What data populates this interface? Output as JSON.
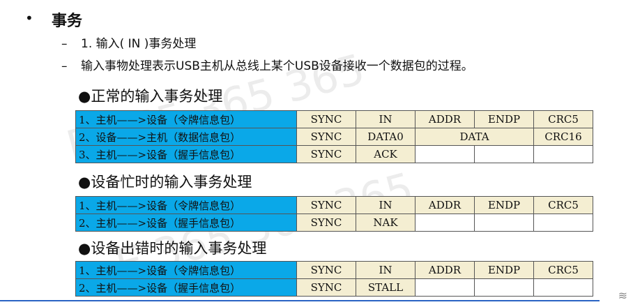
{
  "title": "事务",
  "bullet": "•",
  "subitems": [
    "1. 输入( IN )事务处理",
    "输入事物处理表示USB主机从总线上某个USB设备接收一个数据包的过程。"
  ],
  "watermark": "E 365  365  365",
  "sections": [
    {
      "title": "●正常的输入事务处理",
      "rows": [
        {
          "label": "1、主机——>设备（令牌信息包）",
          "cells": [
            "SYNC",
            "IN",
            "ADDR",
            "ENDP",
            "CRC5"
          ]
        },
        {
          "label": "2、设备——>主机（数据信息包）",
          "cells": [
            "SYNC",
            "DATA0",
            "DATA",
            "CRC16"
          ]
        },
        {
          "label": "3、主机——>设备（握手信息包）",
          "cells": [
            "SYNC",
            "ACK",
            "",
            "",
            ""
          ]
        }
      ]
    },
    {
      "title": "●设备忙时的输入事务处理",
      "rows": [
        {
          "label": "1、主机——>设备（令牌信息包）",
          "cells": [
            "SYNC",
            "IN",
            "ADDR",
            "ENDP",
            "CRC5"
          ]
        },
        {
          "label": "2、主机——>设备（握手信息包）",
          "cells": [
            "SYNC",
            "NAK",
            "",
            "",
            ""
          ]
        }
      ]
    },
    {
      "title": "●设备出错时的输入事务处理",
      "rows": [
        {
          "label": "1、主机——>设备（令牌信息包）",
          "cells": [
            "SYNC",
            "IN",
            "ADDR",
            "ENDP",
            "CRC5"
          ]
        },
        {
          "label": "2、主机——>设备（握手信息包）",
          "cells": [
            "SYNC",
            "STALL",
            "",
            "",
            ""
          ]
        }
      ]
    }
  ],
  "colors": {
    "label_bg": "#0aa8e8",
    "cell_bg": "#f4eed2",
    "rule": "#2a63c4"
  }
}
